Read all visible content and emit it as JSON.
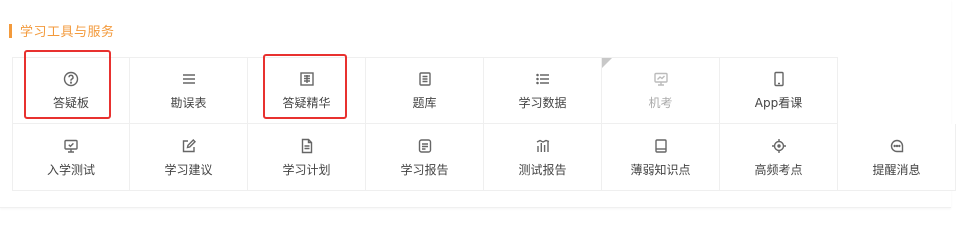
{
  "section": {
    "title": "学习工具与服务",
    "accent_color": "#f39a3c"
  },
  "row1": [
    {
      "label": "答疑板",
      "icon": "question-circle-icon",
      "highlighted": true
    },
    {
      "label": "勘误表",
      "icon": "menu-lines-icon"
    },
    {
      "label": "答疑精华",
      "icon": "essence-book-icon",
      "highlighted": true
    },
    {
      "label": "题库",
      "icon": "document-list-icon"
    },
    {
      "label": "学习数据",
      "icon": "bullet-list-icon"
    },
    {
      "label": "机考",
      "icon": "monitor-chart-icon",
      "disabled": true
    },
    {
      "label": "App看课",
      "icon": "phone-icon"
    }
  ],
  "row2": [
    {
      "label": "入学测试",
      "icon": "monitor-check-icon"
    },
    {
      "label": "学习建议",
      "icon": "edit-icon"
    },
    {
      "label": "学习计划",
      "icon": "file-icon"
    },
    {
      "label": "学习报告",
      "icon": "report-icon"
    },
    {
      "label": "测试报告",
      "icon": "bar-chart-icon"
    },
    {
      "label": "薄弱知识点",
      "icon": "book-icon"
    },
    {
      "label": "高频考点",
      "icon": "target-icon"
    },
    {
      "label": "提醒消息",
      "icon": "chat-bubble-icon"
    }
  ],
  "colors": {
    "highlight": "#e8312f"
  }
}
